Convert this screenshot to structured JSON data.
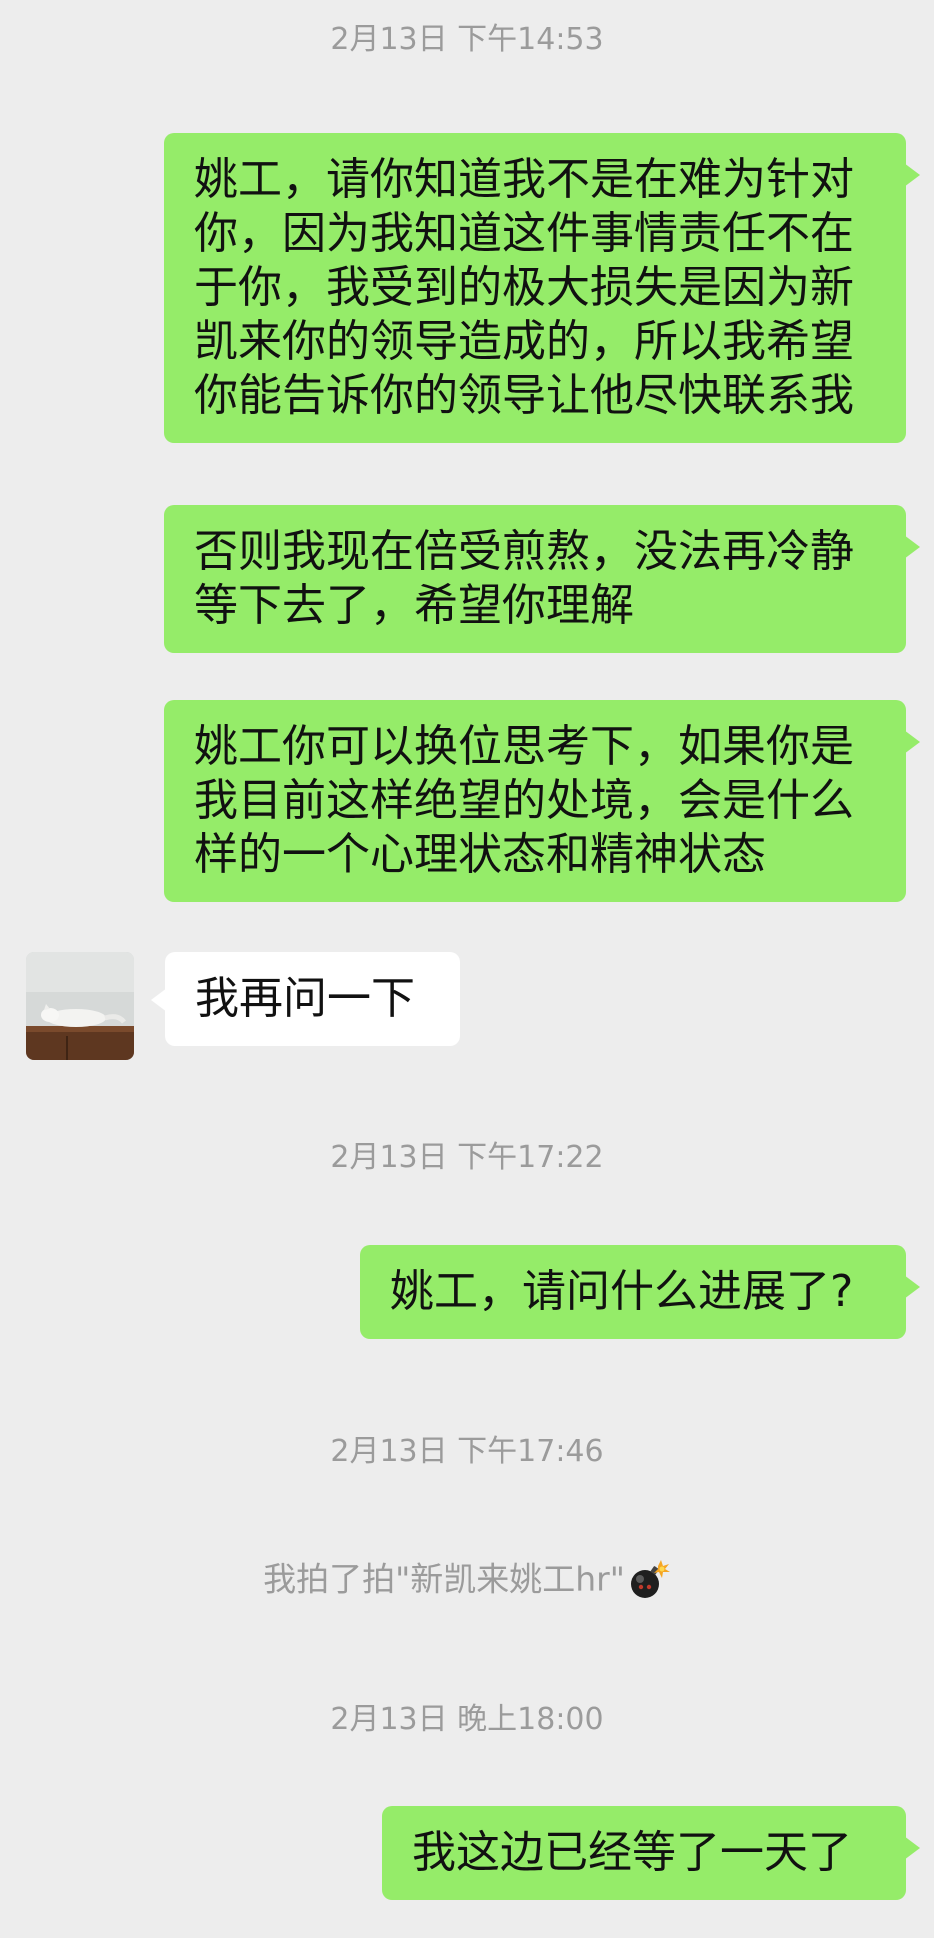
{
  "conversation": {
    "messages": [
      {
        "kind": "timestamp",
        "text": "2月13日 下午14:53"
      },
      {
        "kind": "bubble",
        "sender": "me",
        "text": "姚工，请你知道我不是在难为针对你，因为我知道这件事情责任不在于你，我受到的极大损失是因为新凯来你的领导造成的，所以我希望你能告诉你的领导让他尽快联系我"
      },
      {
        "kind": "bubble",
        "sender": "me",
        "text": "否则我现在倍受煎熬，没法再冷静等下去了，希望你理解"
      },
      {
        "kind": "bubble",
        "sender": "me",
        "text": "姚工你可以换位思考下，如果你是我目前这样绝望的处境，会是什么样的一个心理状态和精神状态"
      },
      {
        "kind": "bubble",
        "sender": "other",
        "text": "我再问一下",
        "avatar": "cat-on-cabinet-avatar"
      },
      {
        "kind": "timestamp",
        "text": "2月13日 下午17:22"
      },
      {
        "kind": "bubble",
        "sender": "me",
        "text": "姚工，请问什么进展了?"
      },
      {
        "kind": "timestamp",
        "text": "2月13日 下午17:46"
      },
      {
        "kind": "system",
        "text": "我拍了拍\"新凯来姚工hr\"",
        "icon": "bomb-icon"
      },
      {
        "kind": "timestamp",
        "text": "2月13日 晚上18:00"
      },
      {
        "kind": "bubble",
        "sender": "me",
        "text": "我这边已经等了一天了"
      }
    ]
  },
  "colors": {
    "background": "#ededed",
    "my_bubble": "#95ec69",
    "other_bubble": "#ffffff",
    "timestamp_text": "#9b9b9b"
  }
}
